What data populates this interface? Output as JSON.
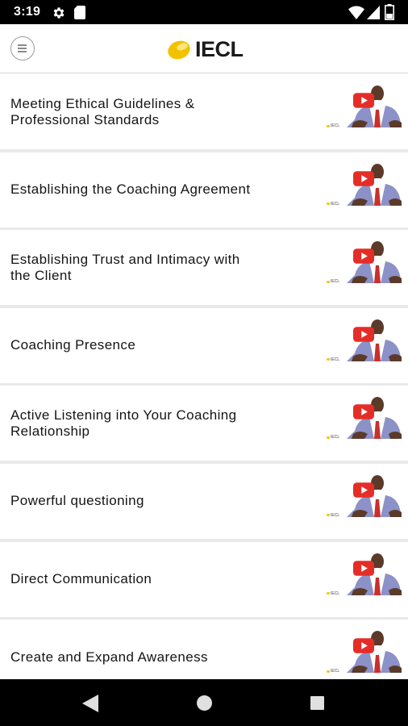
{
  "status_bar": {
    "time": "3:19",
    "icons": [
      "gear-icon",
      "sd-card-icon",
      "wifi-icon",
      "signal-icon",
      "battery-icon"
    ]
  },
  "header": {
    "logo_text": "IECL",
    "menu_icon": "menu-icon",
    "brand_color": "#f2c200"
  },
  "videos": [
    {
      "title": "Meeting Ethical Guidelines & Professional Standards"
    },
    {
      "title": "Establishing the Coaching Agreement"
    },
    {
      "title": "Establishing Trust and Intimacy with the Client"
    },
    {
      "title": "Coaching Presence"
    },
    {
      "title": "Active Listening into Your Coaching Relationship"
    },
    {
      "title": "Powerful questioning"
    },
    {
      "title": "Direct Communication"
    },
    {
      "title": "Create and Expand Awareness"
    }
  ],
  "thumbnail": {
    "play_icon": "play-icon",
    "watermark": "IECL",
    "play_color": "#e52d27"
  },
  "nav_bar": {
    "icons": [
      "back-icon",
      "home-icon",
      "recents-icon"
    ]
  }
}
